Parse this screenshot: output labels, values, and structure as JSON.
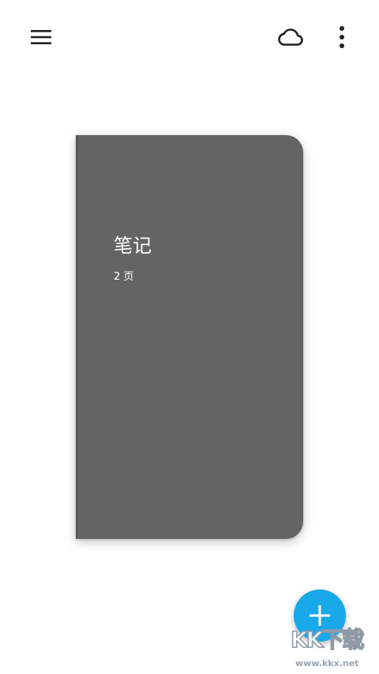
{
  "toolbar": {
    "menu_icon": "hamburger-menu-icon",
    "sync_icon": "cloud-icon",
    "more_icon": "more-vertical-icon"
  },
  "notebook": {
    "title": "笔记",
    "pages": "2 页",
    "cover_color": "#646464"
  },
  "fab": {
    "icon": "plus-icon",
    "color": "#1aa9e8"
  },
  "watermark": {
    "logo": "KK下载",
    "url": "www.kkx.net"
  }
}
